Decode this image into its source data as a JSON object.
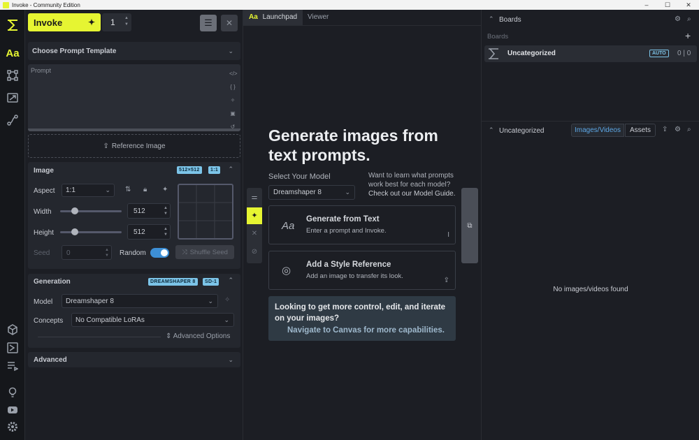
{
  "window": {
    "title": "Invoke - Community Edition",
    "controls": [
      "–",
      "☐",
      "✕"
    ]
  },
  "toolbar": {
    "invoke_label": "Invoke",
    "count": "1"
  },
  "left": {
    "prompt_template": "Choose Prompt Template",
    "prompt_placeholder": "Prompt",
    "reference_image": "Reference Image",
    "image": {
      "title": "Image",
      "badge_size": "512×512",
      "badge_ratio": "1:1",
      "aspect_label": "Aspect",
      "aspect_value": "1:1",
      "width_label": "Width",
      "width_value": "512",
      "width_slider": 0.1,
      "height_label": "Height",
      "height_value": "512",
      "height_slider": 0.1,
      "seed_label": "Seed",
      "seed_value": "0",
      "random_label": "Random",
      "random_on": true,
      "shuffle_label": "Shuffle Seed"
    },
    "generation": {
      "title": "Generation",
      "badge_model": "DREAMSHAPER 8",
      "badge_base": "SD-1",
      "model_label": "Model",
      "model_value": "Dreamshaper 8",
      "concepts_label": "Concepts",
      "concepts_value": "No Compatible LoRAs",
      "advanced_options": "Advanced Options"
    },
    "advanced": {
      "title": "Advanced"
    }
  },
  "center": {
    "tabs": [
      "Launchpad",
      "Viewer"
    ],
    "heading": "Generate images from text prompts.",
    "select_model_label": "Select Your Model",
    "model_value": "Dreamshaper 8",
    "help_text": "Want to learn what prompts work best for each model?",
    "help_link": "Check out our Model Guide.",
    "card1": {
      "title": "Generate from Text",
      "desc": "Enter a prompt and Invoke."
    },
    "card2": {
      "title": "Add a Style Reference",
      "desc": "Add an image to transfer its look."
    },
    "banner": {
      "title": "Looking to get more control, edit, and iterate on your images?",
      "link": "Navigate to Canvas for more capabilities."
    }
  },
  "right": {
    "boards_header": "Boards",
    "boards_label": "Boards",
    "board_name": "Uncategorized",
    "board_auto": "AUTO",
    "board_counts": "0 | 0",
    "gallery_title": "Uncategorized",
    "gallery_tabs": [
      "Images/Videos",
      "Assets"
    ],
    "empty": "No images/videos found"
  },
  "colors": {
    "accent": "#e6f532",
    "badge": "#7cc4e8",
    "toggle": "#3d8fd6",
    "bg": "#1c1e24"
  }
}
